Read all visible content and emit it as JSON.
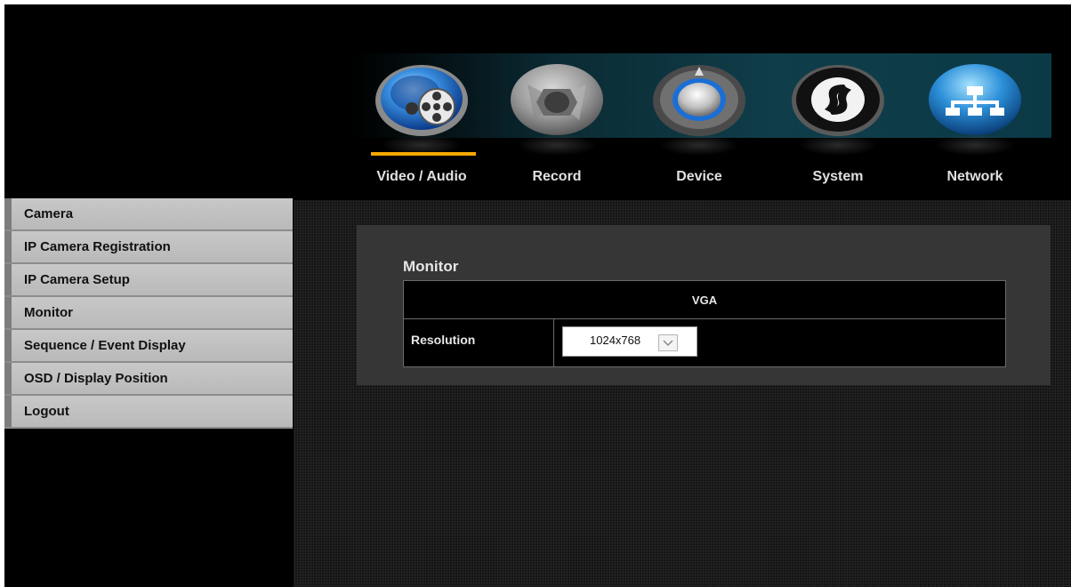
{
  "nav": {
    "tabs": [
      {
        "label": "Video / Audio",
        "icon": "film-reel-icon",
        "active": true
      },
      {
        "label": "Record",
        "icon": "camera-aperture-icon",
        "active": false
      },
      {
        "label": "Device",
        "icon": "device-dial-icon",
        "active": false
      },
      {
        "label": "System",
        "icon": "system-logo-icon",
        "active": false
      },
      {
        "label": "Network",
        "icon": "network-icon",
        "active": false
      }
    ],
    "active_color": "#f5a800"
  },
  "sidebar": {
    "items": [
      {
        "label": "Camera"
      },
      {
        "label": "IP Camera Registration"
      },
      {
        "label": "IP Camera Setup"
      },
      {
        "label": "Monitor"
      },
      {
        "label": "Sequence / Event Display"
      },
      {
        "label": "OSD / Display Position"
      },
      {
        "label": "Logout"
      }
    ]
  },
  "main": {
    "section_title": "Monitor",
    "table": {
      "column_header": "VGA",
      "rows": [
        {
          "label": "Resolution",
          "value": "1024x768"
        }
      ]
    }
  }
}
